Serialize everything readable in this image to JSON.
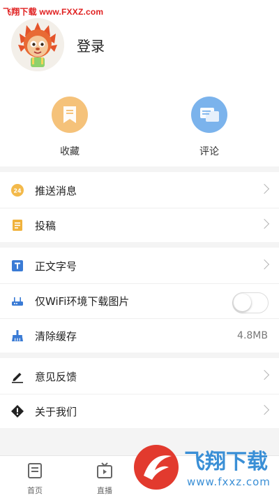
{
  "watermark": {
    "top_text": "飞翔下载 www.FXXZ.com",
    "logo_title": "飞翔下载",
    "logo_url": "www.fxxz.com"
  },
  "header": {
    "login_label": "登录"
  },
  "quick_actions": [
    {
      "label": "收藏",
      "icon": "bookmark-icon",
      "color": "#f5c27a"
    },
    {
      "label": "评论",
      "icon": "comment-icon",
      "color": "#7bb3ec"
    }
  ],
  "settings": {
    "push": {
      "label": "推送消息",
      "icon": "push-notification-icon"
    },
    "submit": {
      "label": "投稿",
      "icon": "document-icon"
    },
    "font": {
      "label": "正文字号",
      "icon": "text-size-icon"
    },
    "wifi": {
      "label": "仅WiFi环境下载图片",
      "icon": "wifi-router-icon",
      "enabled": false
    },
    "cache": {
      "label": "清除缓存",
      "value": "4.8MB",
      "icon": "broom-icon"
    },
    "feedback": {
      "label": "意见反馈",
      "icon": "pencil-icon"
    },
    "about": {
      "label": "关于我们",
      "icon": "info-diamond-icon"
    }
  },
  "tabbar": [
    {
      "label": "首页",
      "icon": "home-icon"
    },
    {
      "label": "直播",
      "icon": "tv-icon"
    }
  ],
  "colors": {
    "accent_orange": "#f5c27a",
    "accent_blue": "#7bb3ec",
    "icon_blue": "#3a7bd5",
    "watermark_red": "#e02020"
  }
}
